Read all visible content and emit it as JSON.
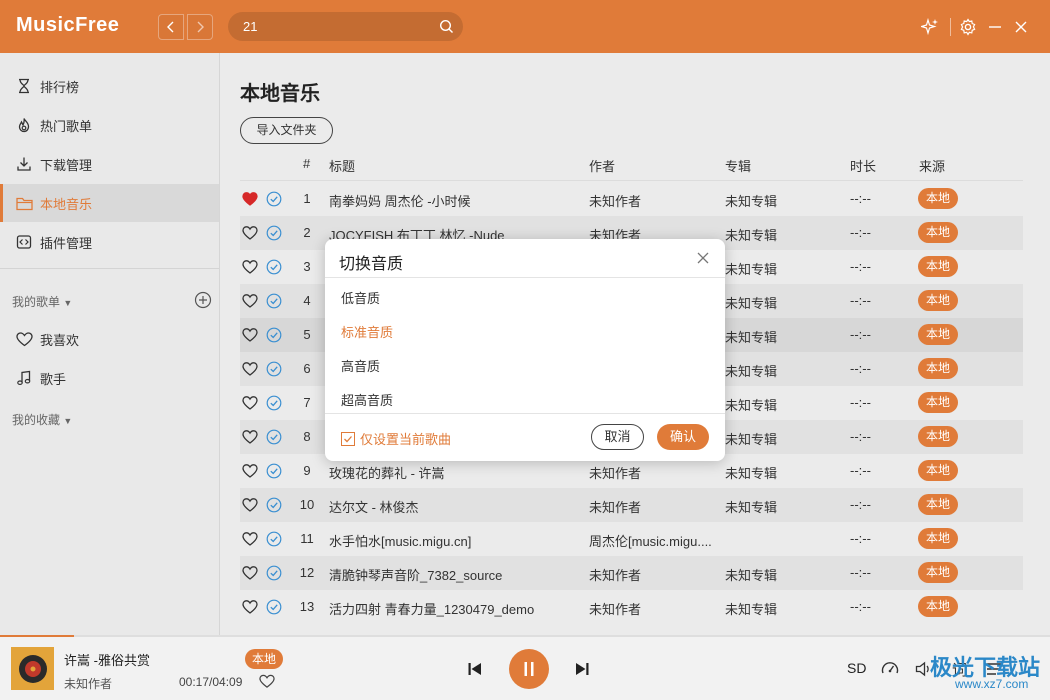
{
  "app": {
    "logo": "MusicFree",
    "search_value": "21",
    "accent": "#e07b39"
  },
  "sidebar": {
    "items": [
      {
        "label": "排行榜",
        "icon": "hourglass-icon"
      },
      {
        "label": "热门歌单",
        "icon": "flame-icon"
      },
      {
        "label": "下载管理",
        "icon": "download-icon"
      },
      {
        "label": "本地音乐",
        "icon": "folder-icon"
      },
      {
        "label": "插件管理",
        "icon": "plugin-icon"
      }
    ],
    "my_playlists": "我的歌单",
    "favorites": "我喜欢",
    "singers": "歌手",
    "my_collections": "我的收藏"
  },
  "main": {
    "title": "本地音乐",
    "import_btn": "导入文件夹",
    "columns": {
      "num": "#",
      "title": "标题",
      "author": "作者",
      "album": "专辑",
      "duration": "时长",
      "source": "来源"
    },
    "rows": [
      {
        "num": "1",
        "title": "南拳妈妈 周杰伦 -小时候",
        "author": "未知作者",
        "album": "未知专辑",
        "duration": "--:--",
        "source": "本地",
        "liked": true
      },
      {
        "num": "2",
        "title": "JOCYFISH 布丁丁 林忆 -Nude",
        "author": "未知作者",
        "album": "未知专辑",
        "duration": "--:--",
        "source": "本地",
        "liked": false
      },
      {
        "num": "3",
        "title": "",
        "author": "",
        "album": "未知专辑",
        "duration": "--:--",
        "source": "本地",
        "liked": false
      },
      {
        "num": "4",
        "title": "",
        "author": "",
        "album": "未知专辑",
        "duration": "--:--",
        "source": "本地",
        "liked": false
      },
      {
        "num": "5",
        "title": "",
        "author": "",
        "album": "未知专辑",
        "duration": "--:--",
        "source": "本地",
        "liked": false
      },
      {
        "num": "6",
        "title": "",
        "author": "",
        "album": "未知专辑",
        "duration": "--:--",
        "source": "本地",
        "liked": false
      },
      {
        "num": "7",
        "title": "",
        "author": "",
        "album": "未知专辑",
        "duration": "--:--",
        "source": "本地",
        "liked": false
      },
      {
        "num": "8",
        "title": "",
        "author": "",
        "album": "未知专辑",
        "duration": "--:--",
        "source": "本地",
        "liked": false
      },
      {
        "num": "9",
        "title": "玫瑰花的葬礼 - 许嵩",
        "author": "未知作者",
        "album": "未知专辑",
        "duration": "--:--",
        "source": "本地",
        "liked": false
      },
      {
        "num": "10",
        "title": "达尔文 - 林俊杰",
        "author": "未知作者",
        "album": "未知专辑",
        "duration": "--:--",
        "source": "本地",
        "liked": false
      },
      {
        "num": "11",
        "title": "水手怕水[music.migu.cn]",
        "author": "周杰伦[music.migu....",
        "album": "",
        "duration": "--:--",
        "source": "本地",
        "liked": false
      },
      {
        "num": "12",
        "title": "清脆钟琴声音阶_7382_source",
        "author": "未知作者",
        "album": "未知专辑",
        "duration": "--:--",
        "source": "本地",
        "liked": false
      },
      {
        "num": "13",
        "title": "活力四射 青春力量_1230479_demo",
        "author": "未知作者",
        "album": "未知专辑",
        "duration": "--:--",
        "source": "本地",
        "liked": false
      }
    ]
  },
  "modal": {
    "title": "切换音质",
    "options": [
      "低音质",
      "标准音质",
      "高音质",
      "超高音质"
    ],
    "selected_index": 1,
    "only_current": "仅设置当前歌曲",
    "cancel": "取消",
    "confirm": "确认"
  },
  "player": {
    "title": "许嵩 -雅俗共赏",
    "artist": "未知作者",
    "badge": "本地",
    "time": "00:17/04:09",
    "progress": 0.07,
    "quality": "SD",
    "lyric_label": "词"
  },
  "watermark": {
    "text": "极光下载站",
    "url": "www.xz7.com"
  }
}
